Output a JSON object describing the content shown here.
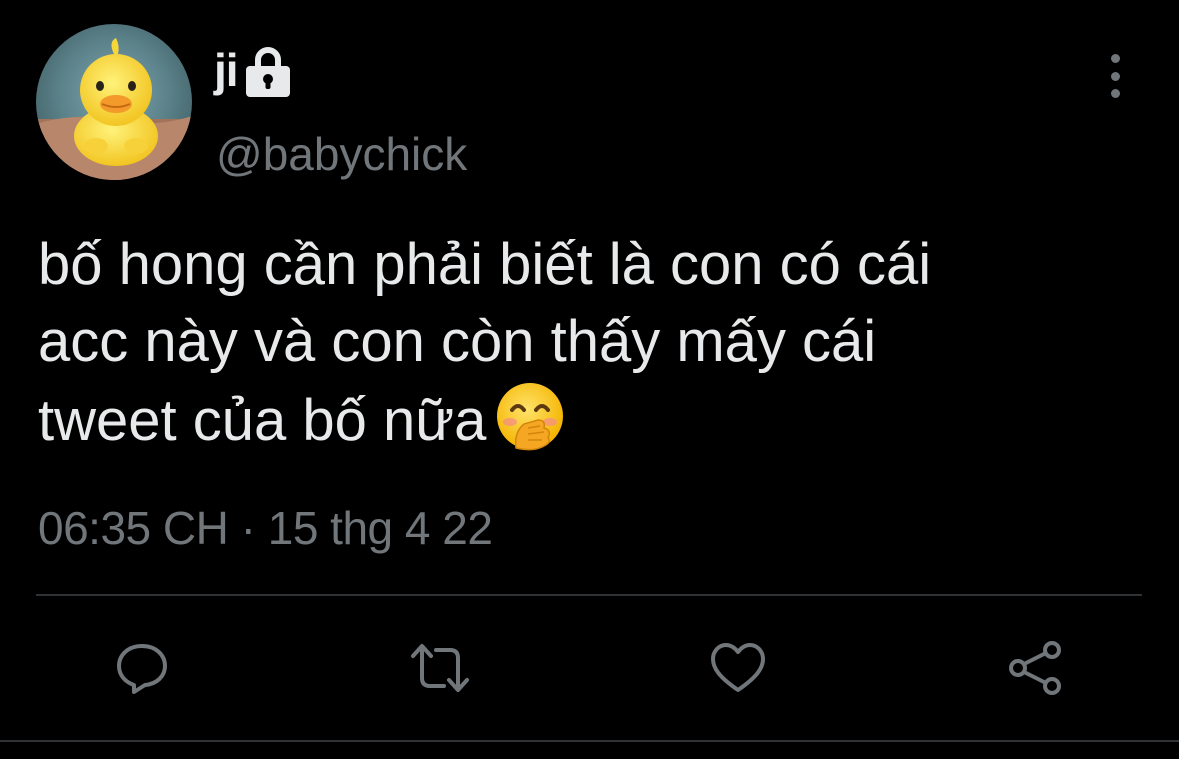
{
  "user": {
    "display_name": "ji",
    "handle": "@babychick",
    "protected_icon": "lock-icon",
    "avatar_icon": "duck-avatar"
  },
  "tweet": {
    "text": "bố hong cần phải biết là con có cái\nacc này và con còn thấy mấy cái\ntweet của bố nữa",
    "emoji": "smiling-face-with-hand-over-mouth",
    "time": "06:35 CH",
    "separator": "·",
    "date": "15 thg 4 22"
  },
  "actions": [
    {
      "name": "reply",
      "icon": "comment-icon"
    },
    {
      "name": "retweet",
      "icon": "retweet-icon"
    },
    {
      "name": "like",
      "icon": "heart-icon"
    },
    {
      "name": "share",
      "icon": "share-icon"
    }
  ],
  "colors": {
    "background": "#000000",
    "primary_text": "#e7e9ea",
    "secondary_text": "#71767b",
    "divider": "#2f3336"
  }
}
